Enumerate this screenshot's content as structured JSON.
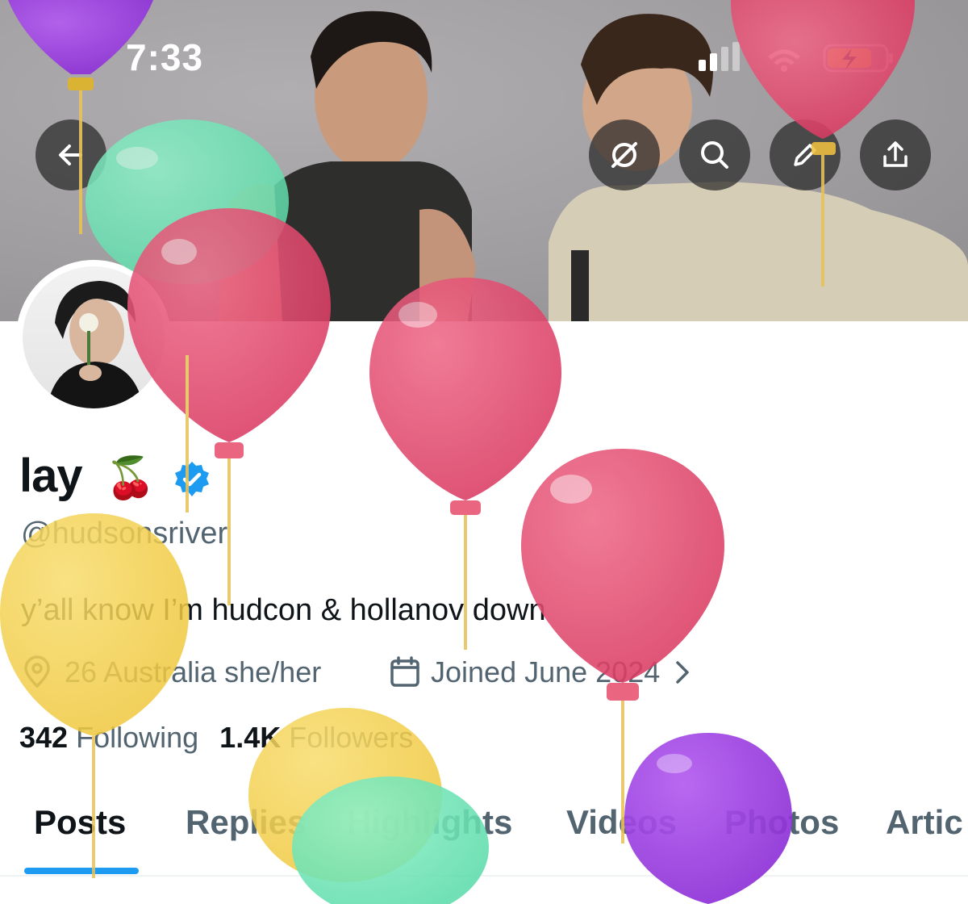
{
  "status_bar": {
    "time": "7:33"
  },
  "profile": {
    "name": "lay",
    "emoji": "🍒",
    "handle": "@hudsonsriver",
    "bio": "y’all know I’m hudcon & hollanov down",
    "location": "26 Australia she/her",
    "joined": "Joined June 2024",
    "following_count": "342",
    "following_label": "Following",
    "followers_count": "1.4K",
    "followers_label": "Followers"
  },
  "tabs": [
    {
      "label": "Posts",
      "active": true
    },
    {
      "label": "Replies",
      "active": false
    },
    {
      "label": "Highlights",
      "active": false
    },
    {
      "label": "Videos",
      "active": false
    },
    {
      "label": "Photos",
      "active": false
    },
    {
      "label": "Artic",
      "active": false
    }
  ],
  "icons": {
    "back": "arrow-left-icon",
    "grok": "slashed-circle-icon",
    "search": "search-icon",
    "edit": "pencil-icon",
    "share": "share-icon",
    "location": "location-pin-icon",
    "calendar": "calendar-icon",
    "verified": "verified-badge-icon",
    "chevron": "chevron-right-icon"
  },
  "colors": {
    "accent": "#1d9bf0",
    "text": "#0f1419",
    "muted": "#536471",
    "balloon_red": "#e0456a",
    "balloon_green": "#6fe3b4",
    "balloon_yellow": "#f2cf4e",
    "balloon_purple": "#9b3fe0",
    "battery": "#f5d342"
  }
}
